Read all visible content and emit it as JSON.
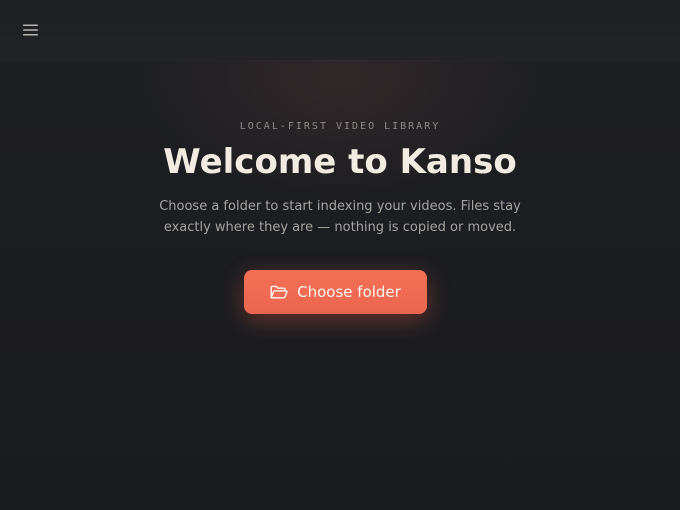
{
  "header": {
    "menu_icon": "hamburger-menu-icon"
  },
  "hero": {
    "eyebrow": "LOCAL-FIRST VIDEO LIBRARY",
    "title": "Welcome to Kanso",
    "subtitle": "Choose a folder to start indexing your videos. Files stay exactly where they are — nothing is copied or moved.",
    "cta_label": "Choose folder",
    "cta_icon": "folder-open-icon"
  },
  "colors": {
    "accent": "#ef6a52",
    "background": "#1d1e22",
    "title_text": "#f1ebe1",
    "muted_text": "#a7a49f"
  }
}
